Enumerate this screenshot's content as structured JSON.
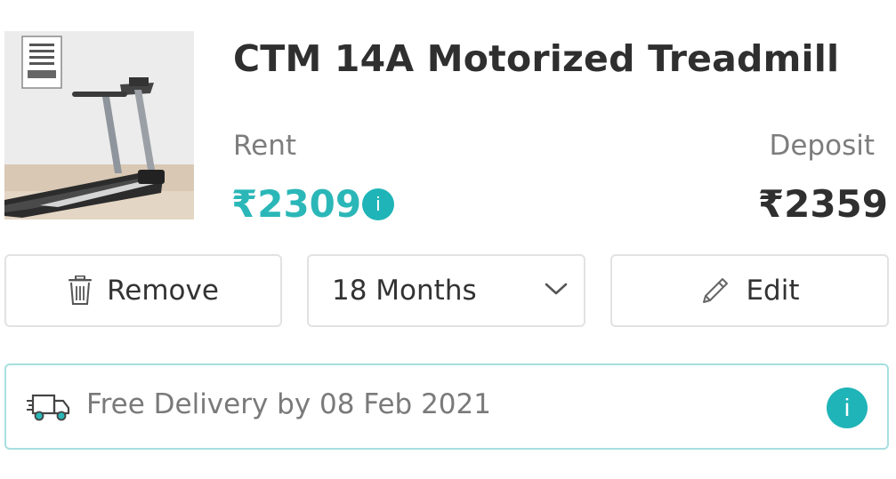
{
  "product": {
    "title": "CTM 14A Motorized Treadmill",
    "image_alt": "treadmill-photo"
  },
  "pricing": {
    "rent_label": "Rent",
    "rent_value": "₹2309",
    "deposit_label": "Deposit",
    "deposit_value": "₹2359",
    "info_glyph": "i",
    "accent_color": "#2bb7b8"
  },
  "actions": {
    "remove_label": "Remove",
    "duration_value": "18 Months",
    "edit_label": "Edit"
  },
  "delivery": {
    "text": "Free Delivery by 08 Feb 2021",
    "info_glyph": "i"
  },
  "icons": {
    "remove": "trash-icon",
    "duration": "chevron-down-icon",
    "edit": "pencil-icon",
    "delivery": "truck-icon",
    "info": "info-icon"
  }
}
